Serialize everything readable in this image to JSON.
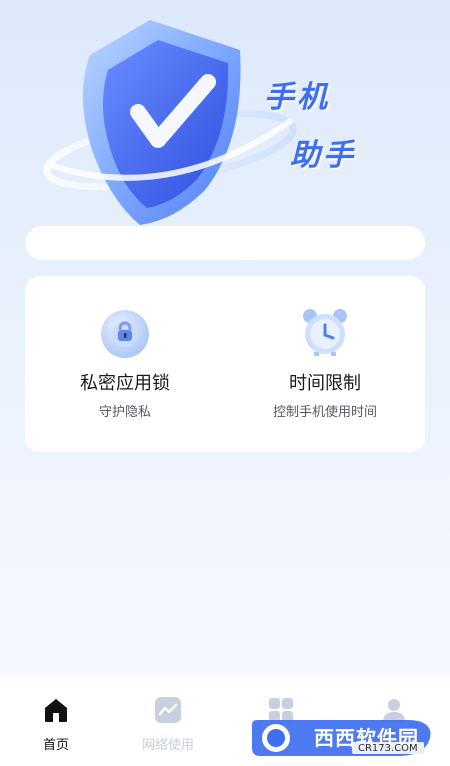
{
  "hero": {
    "title_line1": "手机",
    "title_line2": "助手",
    "image_icon": "shield-check-icon"
  },
  "search": {
    "value": ""
  },
  "features": [
    {
      "title": "私密应用锁",
      "subtitle": "守护隐私",
      "icon": "lock-icon"
    },
    {
      "title": "时间限制",
      "subtitle": "控制手机使用时间",
      "icon": "alarm-clock-icon"
    }
  ],
  "tabbar": {
    "tabs": [
      {
        "label": "首页",
        "icon": "home-icon",
        "active": true
      },
      {
        "label": "网络使用",
        "icon": "chart-icon",
        "active": false
      },
      {
        "label": "",
        "icon": "grid-icon",
        "active": false
      },
      {
        "label": "",
        "icon": "user-icon",
        "active": false
      }
    ]
  },
  "watermark": {
    "text": "西西软件园",
    "url": "CR173.COM"
  },
  "colors": {
    "accent": "#3f6ff0",
    "background_top": "#dde9fb",
    "card": "#ffffff",
    "tab_active": "#111111",
    "tab_inactive": "#c7cfe0"
  }
}
